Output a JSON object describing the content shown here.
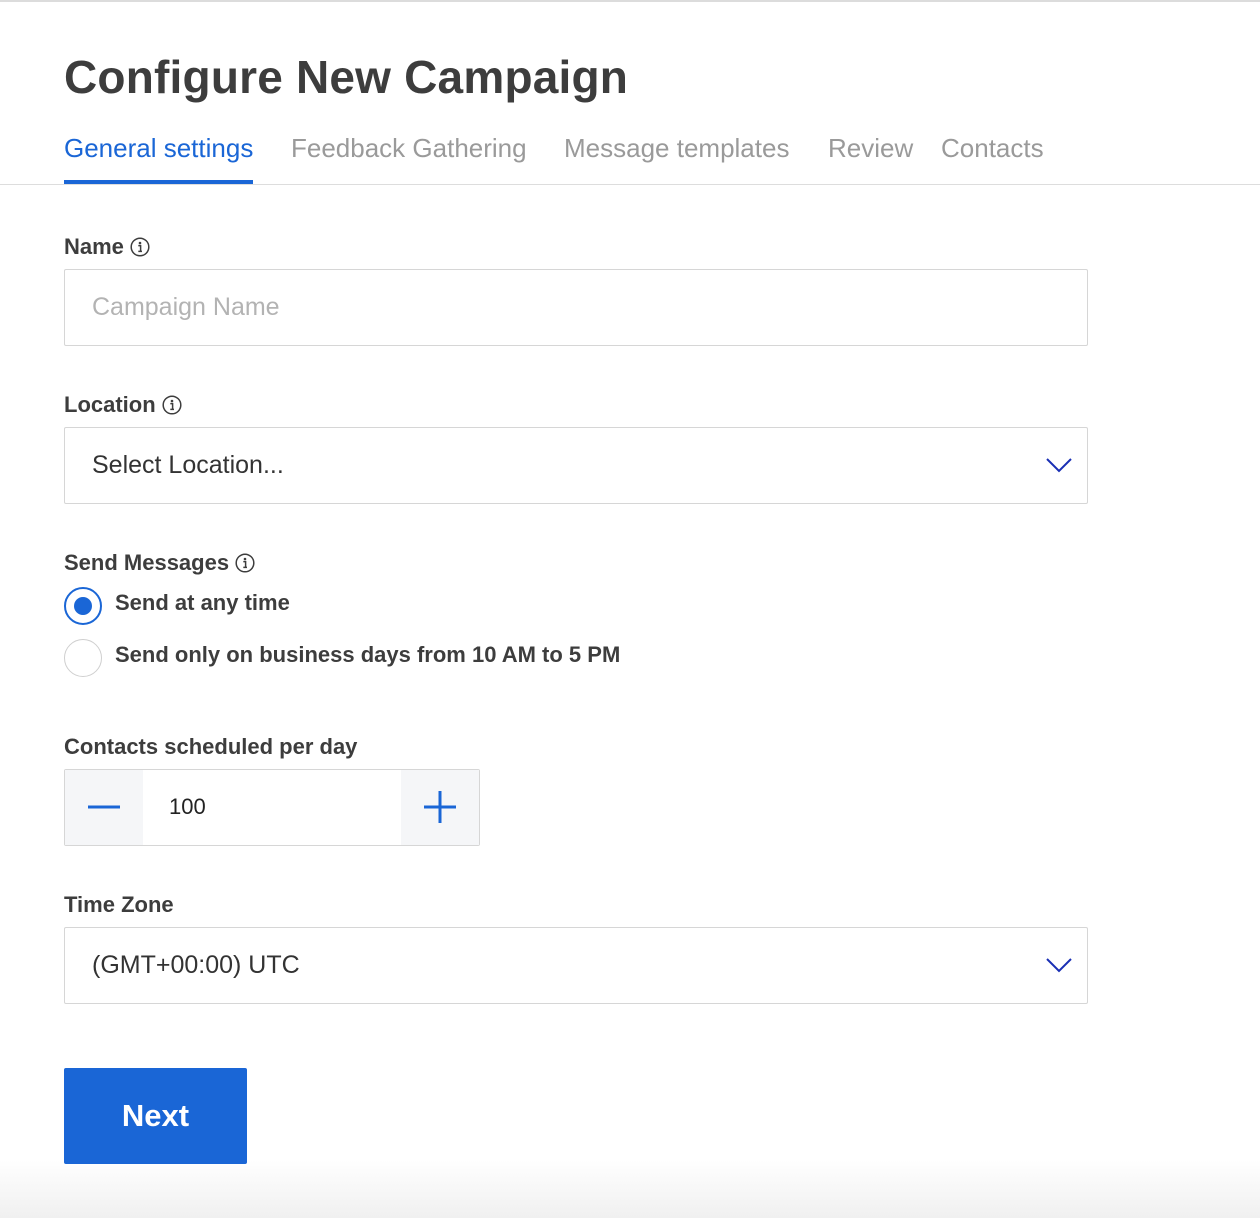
{
  "page": {
    "title": "Configure New Campaign"
  },
  "tabs": [
    {
      "label": "General settings",
      "active": true
    },
    {
      "label": "Feedback Gathering",
      "active": false
    },
    {
      "label": "Message templates",
      "active": false
    },
    {
      "label": "Review",
      "active": false
    },
    {
      "label": "Contacts",
      "active": false
    }
  ],
  "form": {
    "name": {
      "label": "Name",
      "placeholder": "Campaign Name",
      "value": "",
      "icon": "info-icon"
    },
    "location": {
      "label": "Location",
      "selected": "Select Location...",
      "icon": "info-icon"
    },
    "send_messages": {
      "label": "Send Messages",
      "icon": "info-icon",
      "options": [
        {
          "label": "Send at any time",
          "checked": true
        },
        {
          "label": "Send only on business days from 10 AM to 5 PM",
          "checked": false
        }
      ]
    },
    "contacts_per_day": {
      "label": "Contacts scheduled per day",
      "value": "100",
      "decrement_icon": "minus-icon",
      "increment_icon": "plus-icon"
    },
    "time_zone": {
      "label": "Time Zone",
      "selected": "(GMT+00:00) UTC"
    }
  },
  "actions": {
    "next_label": "Next"
  },
  "colors": {
    "accent": "#1a66d6",
    "title": "#3d3d3d",
    "inactive_tab": "#9a9a9a",
    "placeholder": "#b3b3b3",
    "border": "#d6d6d6",
    "chevron": "#1a2fb4"
  }
}
